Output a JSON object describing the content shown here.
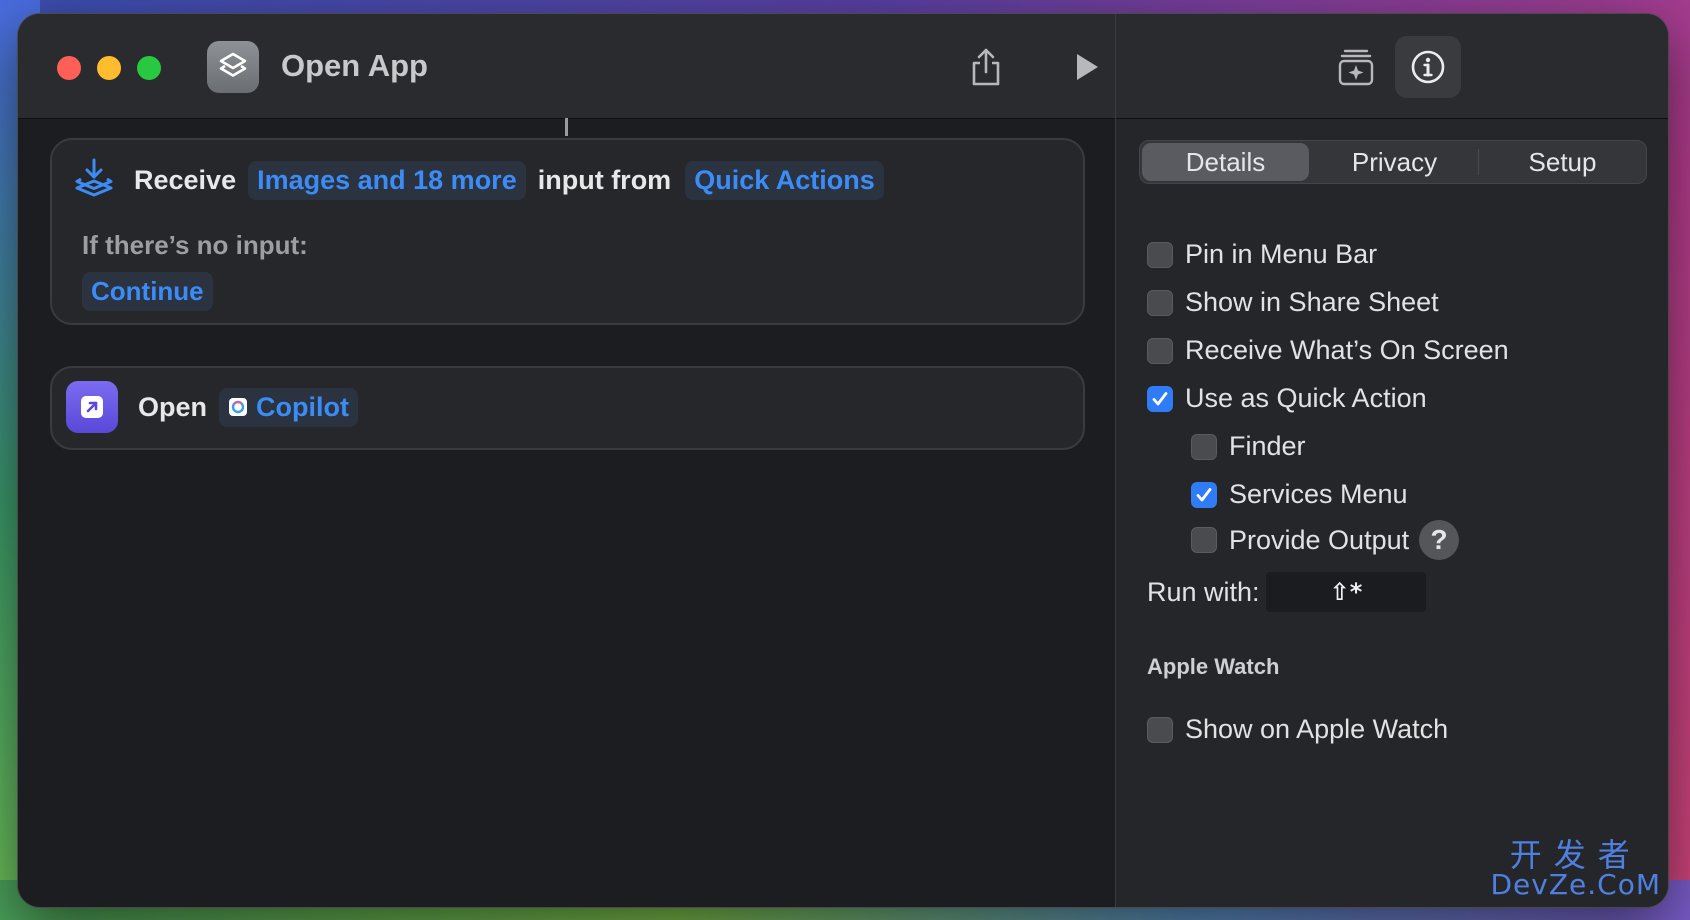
{
  "window": {
    "title": "Open App"
  },
  "actions": {
    "receive": {
      "verb": "Receive",
      "input_types": "Images and 18 more",
      "connector": "input from",
      "source": "Quick Actions",
      "no_input_label": "If there’s no input:",
      "no_input_action": "Continue"
    },
    "open": {
      "verb": "Open",
      "app": "Copilot"
    }
  },
  "inspector": {
    "tabs": [
      {
        "label": "Details",
        "active": true
      },
      {
        "label": "Privacy",
        "active": false
      },
      {
        "label": "Setup",
        "active": false
      }
    ],
    "options": [
      {
        "label": "Pin in Menu Bar",
        "checked": false
      },
      {
        "label": "Show in Share Sheet",
        "checked": false
      },
      {
        "label": "Receive What’s On Screen",
        "checked": false
      },
      {
        "label": "Use as Quick Action",
        "checked": true
      },
      {
        "label": "Finder",
        "checked": false
      },
      {
        "label": "Services Menu",
        "checked": true
      },
      {
        "label": "Provide Output",
        "checked": false
      }
    ],
    "help_glyph": "?",
    "run_with_label": "Run with:",
    "run_with_shortcut": "⇧*",
    "apple_watch_heading": "Apple Watch",
    "apple_watch_option": {
      "label": "Show on Apple Watch",
      "checked": false
    }
  },
  "watermark": {
    "top": "开发者",
    "bottom": "DevZe.CoM"
  },
  "colors": {
    "accent": "#3c8cf5",
    "checkbox_checked": "#2f7cf6",
    "traffic_red": "#fe5f57",
    "traffic_yellow": "#febc2e",
    "traffic_green": "#28c840"
  }
}
